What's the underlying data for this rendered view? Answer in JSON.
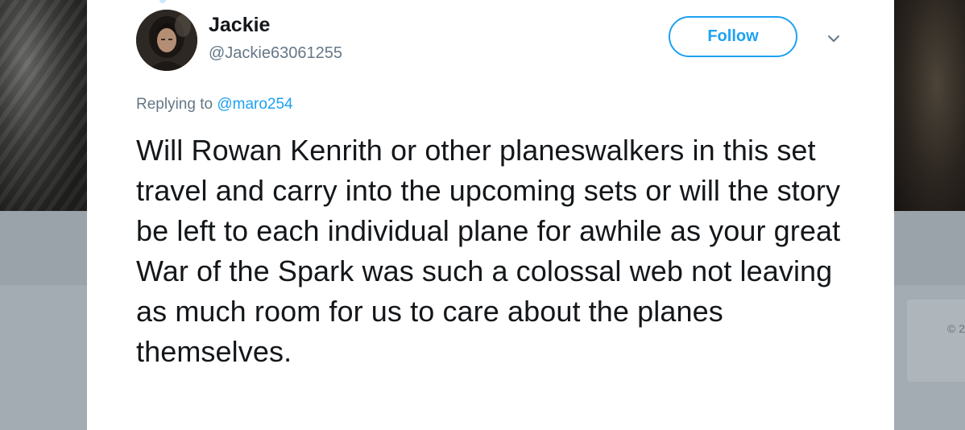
{
  "background": {
    "copyright_fragment": "© 2"
  },
  "tweet": {
    "author": {
      "name": "Jackie",
      "handle": "@Jackie63061255"
    },
    "follow_label": "Follow",
    "menu_icon": "chevron-down-icon",
    "reply_prefix": "Replying to",
    "reply_to": "@maro254",
    "text": "Will Rowan Kenrith or other planeswalkers in this set travel and carry into the upcoming sets or will the story be left to each individual plane for awhile as your great War of the Spark was such a colossal web not leaving as much room for us to care about the planes themselves."
  },
  "colors": {
    "accent": "#1da1f2",
    "text_primary": "#14171a",
    "text_secondary": "#657786",
    "overlay": "#a5aeb5"
  }
}
